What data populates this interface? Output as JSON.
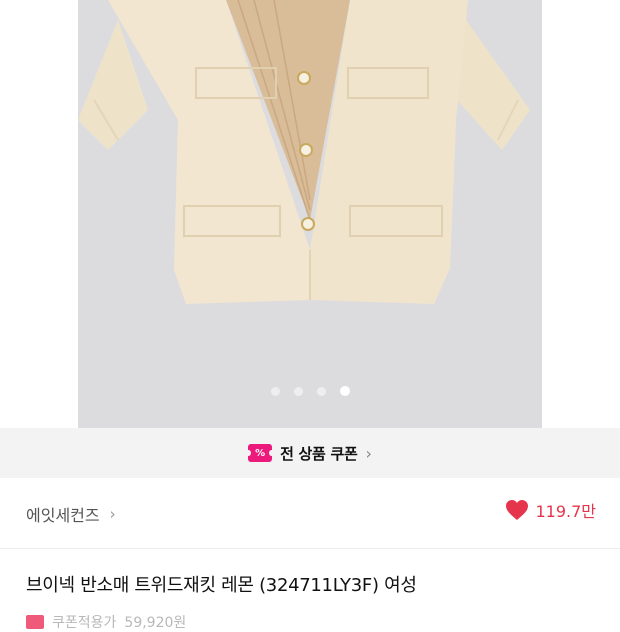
{
  "gallery": {
    "image_alt": "트위드 재킷 상품 이미지",
    "slide_count": 4,
    "active_slide": 4
  },
  "coupon_bar": {
    "icon_name": "coupon-icon",
    "icon_text": "%",
    "label": "전 상품 쿠폰",
    "chevron": "›"
  },
  "brand_row": {
    "brand_name": "에잇세컨즈",
    "chevron": "›",
    "like_icon": "heart-icon",
    "like_count": "119.7만",
    "like_color": "#e5354d"
  },
  "product": {
    "title": "브이넥 반소매 트위드재킷 레몬 (324711LY3F) 여성"
  },
  "promo": {
    "label": "쿠폰적용가",
    "price": "59,920원"
  },
  "colors": {
    "accent_pink": "#ec1a7a",
    "photo_bg": "#dcdcdf",
    "jacket": "#f2e6d0"
  }
}
